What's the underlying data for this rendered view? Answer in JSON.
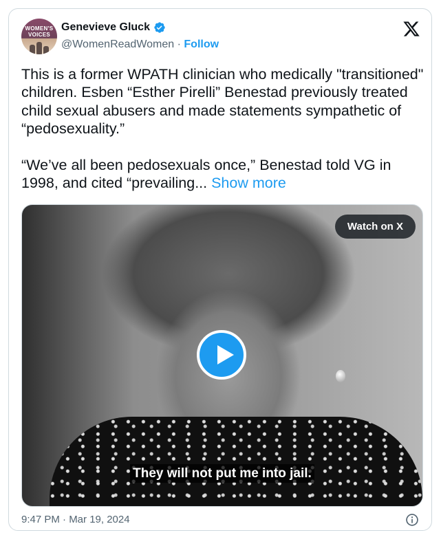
{
  "author": {
    "avatar_text": "WOMEN'S\nVOICES",
    "name": "Genevieve Gluck",
    "handle": "@WomenReadWomen",
    "separator": " · ",
    "follow_label": "Follow",
    "verified": true
  },
  "tweet": {
    "text": "This is a former WPATH clinician who medically \"transitioned\" children. Esben “Esther Pirelli” Benestad previously treated child sexual abusers and made statements sympathetic of “pedosexuality.”\n\n“We’ve all been pedosexuals once,” Benestad told VG in 1998, and cited “prevailing... ",
    "show_more_label": "Show more"
  },
  "media": {
    "watch_label": "Watch on X",
    "caption": "They will not put me into jail."
  },
  "footer": {
    "timestamp": "9:47 PM · Mar 19, 2024"
  },
  "colors": {
    "accent": "#1d9bf0",
    "text": "#0f1419",
    "secondary": "#536471"
  },
  "icons": [
    "verified-badge-icon",
    "x-logo-icon",
    "play-icon",
    "info-icon"
  ]
}
